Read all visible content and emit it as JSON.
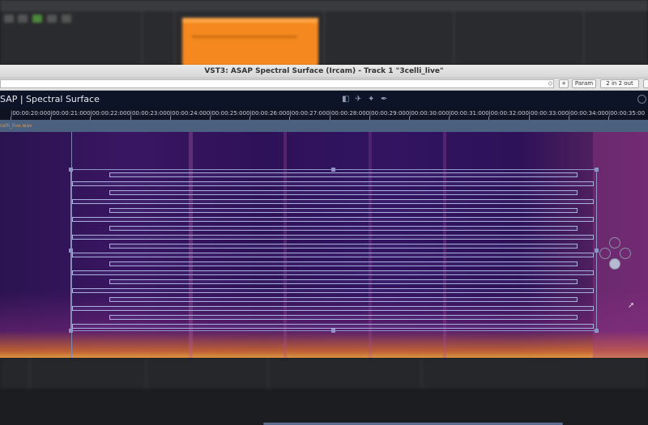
{
  "window": {
    "title": "VST3: ASAP Spectral Surface (Ircam) - Track 1 \"3celli_live\""
  },
  "toolbar": {
    "preset_arrows": "◇",
    "plus": "+",
    "param": "Param",
    "io": "2 in 2 out"
  },
  "plugin": {
    "title": "SAP | Spectral Surface",
    "icons": [
      "square-icon",
      "bird-icon",
      "magic-wand-icon",
      "feather-icon",
      "settings-circle-icon"
    ]
  },
  "ruler": {
    "labels": [
      "|00:00:20:000",
      "|00:00:21:000",
      "|00:00:22:000",
      "|00:00:23:000",
      "|00:00:24:000",
      "|00:00:25:000",
      "|00:00:26:000",
      "|00:00:27:000",
      "|00:00:28:000",
      "|00:00:29:000",
      "|00:00:30:000",
      "|00:00:31:000",
      "|00:00:32:000",
      "|00:00:33:000",
      "|00:00:34:000",
      "|00:00:35:00"
    ]
  },
  "track": {
    "name": "celli_live.wav"
  },
  "colors": {
    "spectrogram_dark": "#2a1350",
    "spectrogram_hot": "#f59a3a",
    "selection": "#8f96c8",
    "daw_clip": "#f5891f"
  }
}
